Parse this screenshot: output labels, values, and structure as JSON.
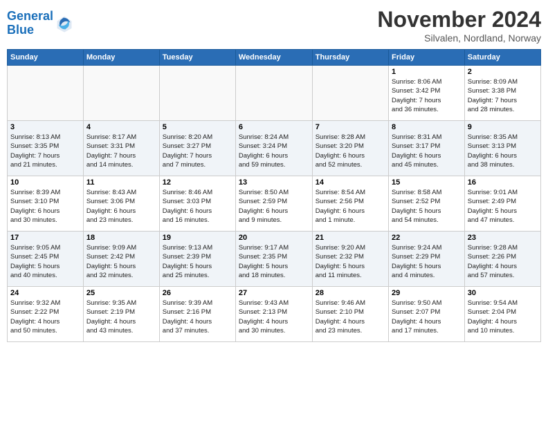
{
  "header": {
    "logo_line1": "General",
    "logo_line2": "Blue",
    "month": "November 2024",
    "location": "Silvalen, Nordland, Norway"
  },
  "weekdays": [
    "Sunday",
    "Monday",
    "Tuesday",
    "Wednesday",
    "Thursday",
    "Friday",
    "Saturday"
  ],
  "weeks": [
    [
      {
        "day": "",
        "info": ""
      },
      {
        "day": "",
        "info": ""
      },
      {
        "day": "",
        "info": ""
      },
      {
        "day": "",
        "info": ""
      },
      {
        "day": "",
        "info": ""
      },
      {
        "day": "1",
        "info": "Sunrise: 8:06 AM\nSunset: 3:42 PM\nDaylight: 7 hours\nand 36 minutes."
      },
      {
        "day": "2",
        "info": "Sunrise: 8:09 AM\nSunset: 3:38 PM\nDaylight: 7 hours\nand 28 minutes."
      }
    ],
    [
      {
        "day": "3",
        "info": "Sunrise: 8:13 AM\nSunset: 3:35 PM\nDaylight: 7 hours\nand 21 minutes."
      },
      {
        "day": "4",
        "info": "Sunrise: 8:17 AM\nSunset: 3:31 PM\nDaylight: 7 hours\nand 14 minutes."
      },
      {
        "day": "5",
        "info": "Sunrise: 8:20 AM\nSunset: 3:27 PM\nDaylight: 7 hours\nand 7 minutes."
      },
      {
        "day": "6",
        "info": "Sunrise: 8:24 AM\nSunset: 3:24 PM\nDaylight: 6 hours\nand 59 minutes."
      },
      {
        "day": "7",
        "info": "Sunrise: 8:28 AM\nSunset: 3:20 PM\nDaylight: 6 hours\nand 52 minutes."
      },
      {
        "day": "8",
        "info": "Sunrise: 8:31 AM\nSunset: 3:17 PM\nDaylight: 6 hours\nand 45 minutes."
      },
      {
        "day": "9",
        "info": "Sunrise: 8:35 AM\nSunset: 3:13 PM\nDaylight: 6 hours\nand 38 minutes."
      }
    ],
    [
      {
        "day": "10",
        "info": "Sunrise: 8:39 AM\nSunset: 3:10 PM\nDaylight: 6 hours\nand 30 minutes."
      },
      {
        "day": "11",
        "info": "Sunrise: 8:43 AM\nSunset: 3:06 PM\nDaylight: 6 hours\nand 23 minutes."
      },
      {
        "day": "12",
        "info": "Sunrise: 8:46 AM\nSunset: 3:03 PM\nDaylight: 6 hours\nand 16 minutes."
      },
      {
        "day": "13",
        "info": "Sunrise: 8:50 AM\nSunset: 2:59 PM\nDaylight: 6 hours\nand 9 minutes."
      },
      {
        "day": "14",
        "info": "Sunrise: 8:54 AM\nSunset: 2:56 PM\nDaylight: 6 hours\nand 1 minute."
      },
      {
        "day": "15",
        "info": "Sunrise: 8:58 AM\nSunset: 2:52 PM\nDaylight: 5 hours\nand 54 minutes."
      },
      {
        "day": "16",
        "info": "Sunrise: 9:01 AM\nSunset: 2:49 PM\nDaylight: 5 hours\nand 47 minutes."
      }
    ],
    [
      {
        "day": "17",
        "info": "Sunrise: 9:05 AM\nSunset: 2:45 PM\nDaylight: 5 hours\nand 40 minutes."
      },
      {
        "day": "18",
        "info": "Sunrise: 9:09 AM\nSunset: 2:42 PM\nDaylight: 5 hours\nand 32 minutes."
      },
      {
        "day": "19",
        "info": "Sunrise: 9:13 AM\nSunset: 2:39 PM\nDaylight: 5 hours\nand 25 minutes."
      },
      {
        "day": "20",
        "info": "Sunrise: 9:17 AM\nSunset: 2:35 PM\nDaylight: 5 hours\nand 18 minutes."
      },
      {
        "day": "21",
        "info": "Sunrise: 9:20 AM\nSunset: 2:32 PM\nDaylight: 5 hours\nand 11 minutes."
      },
      {
        "day": "22",
        "info": "Sunrise: 9:24 AM\nSunset: 2:29 PM\nDaylight: 5 hours\nand 4 minutes."
      },
      {
        "day": "23",
        "info": "Sunrise: 9:28 AM\nSunset: 2:26 PM\nDaylight: 4 hours\nand 57 minutes."
      }
    ],
    [
      {
        "day": "24",
        "info": "Sunrise: 9:32 AM\nSunset: 2:22 PM\nDaylight: 4 hours\nand 50 minutes."
      },
      {
        "day": "25",
        "info": "Sunrise: 9:35 AM\nSunset: 2:19 PM\nDaylight: 4 hours\nand 43 minutes."
      },
      {
        "day": "26",
        "info": "Sunrise: 9:39 AM\nSunset: 2:16 PM\nDaylight: 4 hours\nand 37 minutes."
      },
      {
        "day": "27",
        "info": "Sunrise: 9:43 AM\nSunset: 2:13 PM\nDaylight: 4 hours\nand 30 minutes."
      },
      {
        "day": "28",
        "info": "Sunrise: 9:46 AM\nSunset: 2:10 PM\nDaylight: 4 hours\nand 23 minutes."
      },
      {
        "day": "29",
        "info": "Sunrise: 9:50 AM\nSunset: 2:07 PM\nDaylight: 4 hours\nand 17 minutes."
      },
      {
        "day": "30",
        "info": "Sunrise: 9:54 AM\nSunset: 2:04 PM\nDaylight: 4 hours\nand 10 minutes."
      }
    ]
  ]
}
